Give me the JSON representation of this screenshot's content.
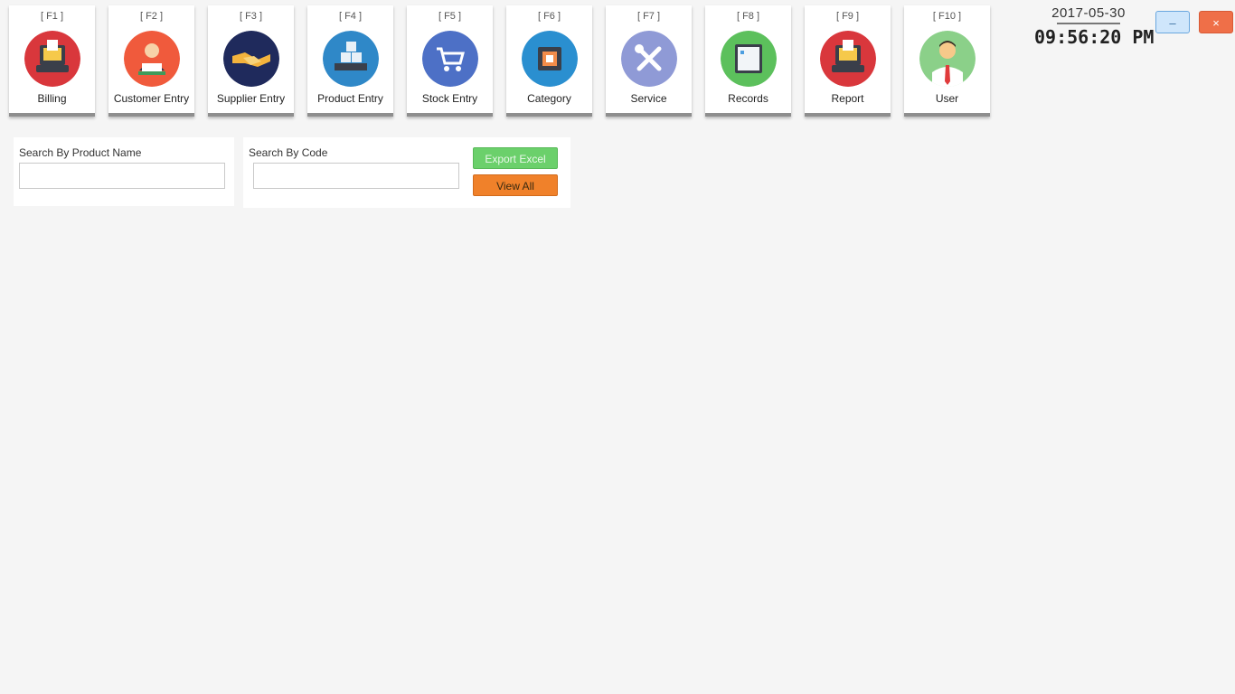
{
  "toolbar": {
    "tiles": [
      {
        "key": "[ F1 ]",
        "label": "Billing"
      },
      {
        "key": "[ F2 ]",
        "label": "Customer Entry"
      },
      {
        "key": "[ F3 ]",
        "label": "Supplier Entry"
      },
      {
        "key": "[ F4 ]",
        "label": "Product Entry"
      },
      {
        "key": "[ F5 ]",
        "label": "Stock Entry"
      },
      {
        "key": "[ F6 ]",
        "label": "Category"
      },
      {
        "key": "[ F7 ]",
        "label": "Service"
      },
      {
        "key": "[ F8 ]",
        "label": "Records"
      },
      {
        "key": "[ F9 ]",
        "label": "Report"
      },
      {
        "key": "[ F10 ]",
        "label": "User"
      }
    ]
  },
  "clock": {
    "date": "2017-05-30",
    "time": "09:56:20 PM"
  },
  "window": {
    "minimize_label": "–",
    "close_label": "×"
  },
  "search": {
    "product_name_label": "Search By Product Name",
    "product_name_value": "",
    "code_label": "Search By Code",
    "code_value": "",
    "export_label": "Export Excel",
    "view_all_label": "View All"
  },
  "colors": {
    "billing": "#d9373c",
    "customer": "#f05a3c",
    "supplier": "#1f2a5c",
    "product": "#2f88c8",
    "stock": "#4d70c6",
    "category": "#2a8fd0",
    "service": "#8f9ad6",
    "records": "#5cc05c",
    "report": "#d9373c",
    "user": "#8bd089",
    "export_button": "#6bd06b",
    "view_all_button": "#f0812a"
  }
}
